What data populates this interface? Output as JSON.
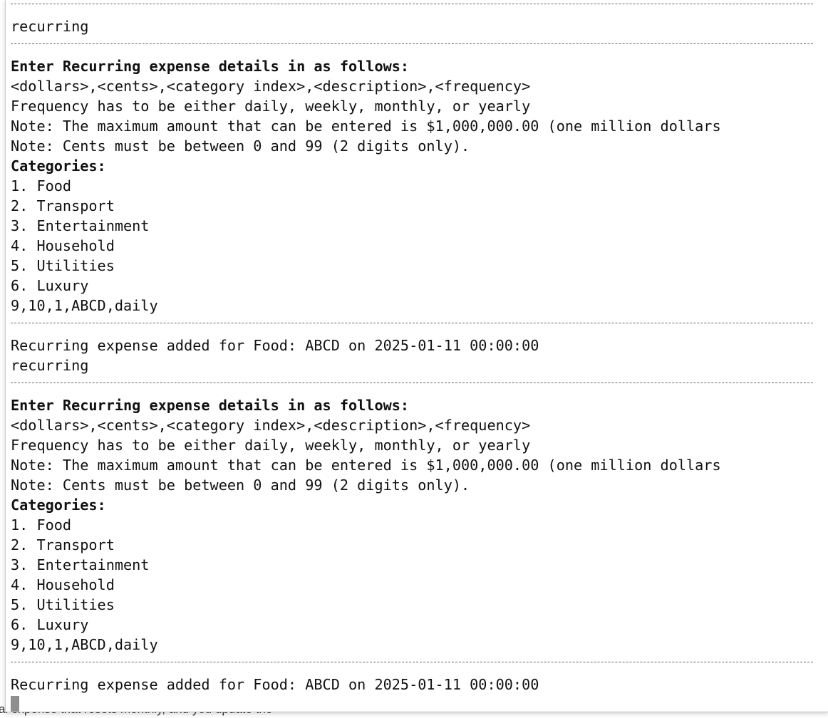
{
  "background_fragments": {
    "bottom_text": "al expense that resets monthly, and you update the"
  },
  "terminal": {
    "lines": [
      {
        "kind": "rule",
        "text": ""
      },
      {
        "kind": "text",
        "text": "recurring"
      },
      {
        "kind": "rule",
        "text": ""
      },
      {
        "kind": "bold",
        "text": "Enter Recurring expense details in as follows:"
      },
      {
        "kind": "text",
        "text": "<dollars>,<cents>,<category index>,<description>,<frequency>"
      },
      {
        "kind": "text",
        "text": "Frequency has to be either daily, weekly, monthly, or yearly"
      },
      {
        "kind": "text",
        "text": "Note: The maximum amount that can be entered is $1,000,000.00 (one million dollars"
      },
      {
        "kind": "text",
        "text": "Note: Cents must be between 0 and 99 (2 digits only)."
      },
      {
        "kind": "bold",
        "text": "Categories:"
      },
      {
        "kind": "text",
        "text": "1. Food"
      },
      {
        "kind": "text",
        "text": "2. Transport"
      },
      {
        "kind": "text",
        "text": "3. Entertainment"
      },
      {
        "kind": "text",
        "text": "4. Household"
      },
      {
        "kind": "text",
        "text": "5. Utilities"
      },
      {
        "kind": "text",
        "text": "6. Luxury"
      },
      {
        "kind": "text",
        "text": "9,10,1,ABCD,daily"
      },
      {
        "kind": "rule",
        "text": ""
      },
      {
        "kind": "text",
        "text": "Recurring expense added for Food: ABCD on 2025-01-11 00:00:00"
      },
      {
        "kind": "text",
        "text": "recurring"
      },
      {
        "kind": "rule",
        "text": ""
      },
      {
        "kind": "bold",
        "text": "Enter Recurring expense details in as follows:"
      },
      {
        "kind": "text",
        "text": "<dollars>,<cents>,<category index>,<description>,<frequency>"
      },
      {
        "kind": "text",
        "text": "Frequency has to be either daily, weekly, monthly, or yearly"
      },
      {
        "kind": "text",
        "text": "Note: The maximum amount that can be entered is $1,000,000.00 (one million dollars"
      },
      {
        "kind": "text",
        "text": "Note: Cents must be between 0 and 99 (2 digits only)."
      },
      {
        "kind": "bold",
        "text": "Categories:"
      },
      {
        "kind": "text",
        "text": "1. Food"
      },
      {
        "kind": "text",
        "text": "2. Transport"
      },
      {
        "kind": "text",
        "text": "3. Entertainment"
      },
      {
        "kind": "text",
        "text": "4. Household"
      },
      {
        "kind": "text",
        "text": "5. Utilities"
      },
      {
        "kind": "text",
        "text": "6. Luxury"
      },
      {
        "kind": "text",
        "text": "9,10,1,ABCD,daily"
      },
      {
        "kind": "rule",
        "text": ""
      },
      {
        "kind": "text",
        "text": "Recurring expense added for Food: ABCD on 2025-01-11 00:00:00"
      },
      {
        "kind": "cursor",
        "text": ""
      }
    ]
  }
}
